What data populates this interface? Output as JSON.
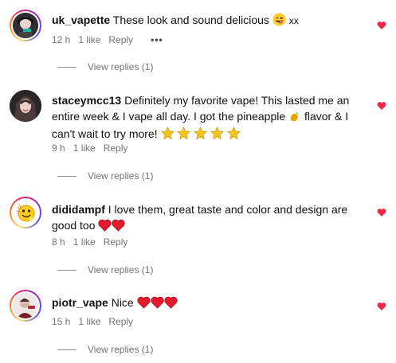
{
  "colors": {
    "like_heart": "#ed2a4a",
    "meta_text": "#737373",
    "star": "#f5c518"
  },
  "comments": [
    {
      "username": "uk_vapette",
      "text": "These look and sound delicious",
      "text_suffix": "xx",
      "time": "12 h",
      "likes": "1 like",
      "reply": "Reply",
      "more": "•••",
      "view_replies": "View replies (1)",
      "avatar_icon": "avatar-uk-vapette",
      "emoji": [
        "face-savoring-food-emoji"
      ]
    },
    {
      "username": "staceymcc13",
      "text_part1": "Definitely my favorite vape! This lasted me an entire week & I vape all day. I got the pineapple",
      "text_part2": "flavor & I can't wait to try more!",
      "time": "9 h",
      "likes": "1 like",
      "reply": "Reply",
      "view_replies": "View replies (1)",
      "avatar_icon": "avatar-staceymcc13",
      "emoji": [
        "pineapple-emoji",
        "star-emoji",
        "star-emoji",
        "star-emoji",
        "star-emoji",
        "star-emoji"
      ]
    },
    {
      "username": "dididampf",
      "text": "I love them, great taste and color and design are good too",
      "time": "8 h",
      "likes": "1 like",
      "reply": "Reply",
      "view_replies": "View replies (1)",
      "avatar_icon": "avatar-dididampf",
      "emoji": [
        "red-heart-emoji",
        "red-heart-emoji"
      ]
    },
    {
      "username": "piotr_vape",
      "text": "Nice",
      "time": "15 h",
      "likes": "1 like",
      "reply": "Reply",
      "view_replies": "View replies (1)",
      "avatar_icon": "avatar-piotr-vape",
      "emoji": [
        "red-heart-emoji",
        "red-heart-emoji",
        "red-heart-emoji"
      ]
    }
  ]
}
